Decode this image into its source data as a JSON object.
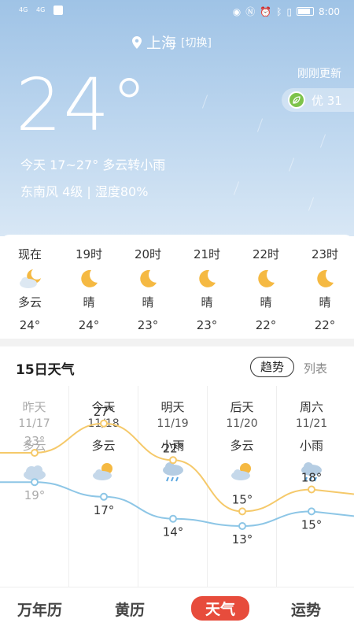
{
  "status_bar": {
    "time": "8:00",
    "battery": "",
    "sim1": "4G",
    "sim2": "4G"
  },
  "location": {
    "city": "上海",
    "switch_label": "[切换]"
  },
  "current": {
    "temperature": "24°",
    "updated": "刚刚更新",
    "aqi": "优 31",
    "today_summary": "今天 17~27°   多云转小雨",
    "wind_humidity": "东南风 4级  |  湿度80%"
  },
  "hourly": [
    {
      "time": "现在",
      "icon": "moon-cloud-icon",
      "weather": "多云",
      "temp": "24°"
    },
    {
      "time": "19时",
      "icon": "moon-icon",
      "weather": "晴",
      "temp": "24°"
    },
    {
      "time": "20时",
      "icon": "moon-icon",
      "weather": "晴",
      "temp": "23°"
    },
    {
      "time": "21时",
      "icon": "moon-icon",
      "weather": "晴",
      "temp": "23°"
    },
    {
      "time": "22时",
      "icon": "moon-icon",
      "weather": "晴",
      "temp": "22°"
    },
    {
      "time": "23时",
      "icon": "moon-icon",
      "weather": "晴",
      "temp": "22°"
    }
  ],
  "forecast": {
    "title": "15日天气",
    "trend_label": "趋势",
    "list_label": "列表",
    "days": [
      {
        "name": "昨天",
        "date": "11/17",
        "weather": "多云",
        "icon": "cloudy-icon",
        "high": "23°",
        "low": "19°"
      },
      {
        "name": "今天",
        "date": "11/18",
        "weather": "多云",
        "icon": "sun-cloud-icon",
        "high": "27°",
        "low": "17°"
      },
      {
        "name": "明天",
        "date": "11/19",
        "weather": "小雨",
        "icon": "rain-icon",
        "high": "22°",
        "low": "14°"
      },
      {
        "name": "后天",
        "date": "11/20",
        "weather": "多云",
        "icon": "sun-cloud-icon",
        "high": "15°",
        "low": "13°"
      },
      {
        "name": "周六",
        "date": "11/21",
        "weather": "小雨",
        "icon": "rain-icon",
        "high": "18°",
        "low": "15°"
      }
    ]
  },
  "chart_data": {
    "type": "line",
    "categories": [
      "11/17",
      "11/18",
      "11/19",
      "11/20",
      "11/21"
    ],
    "series": [
      {
        "values": [
          23,
          27,
          22,
          15,
          18
        ],
        "color": "#f5c96a"
      },
      {
        "values": [
          19,
          17,
          14,
          13,
          15
        ],
        "color": "#8dc6e6"
      }
    ]
  },
  "tabs": [
    "万年历",
    "黄历",
    "天气",
    "运势"
  ],
  "colors": {
    "accent": "#e74c3c",
    "sky_top": "#9fc3e6",
    "aqi_leaf": "#7dc34a"
  }
}
